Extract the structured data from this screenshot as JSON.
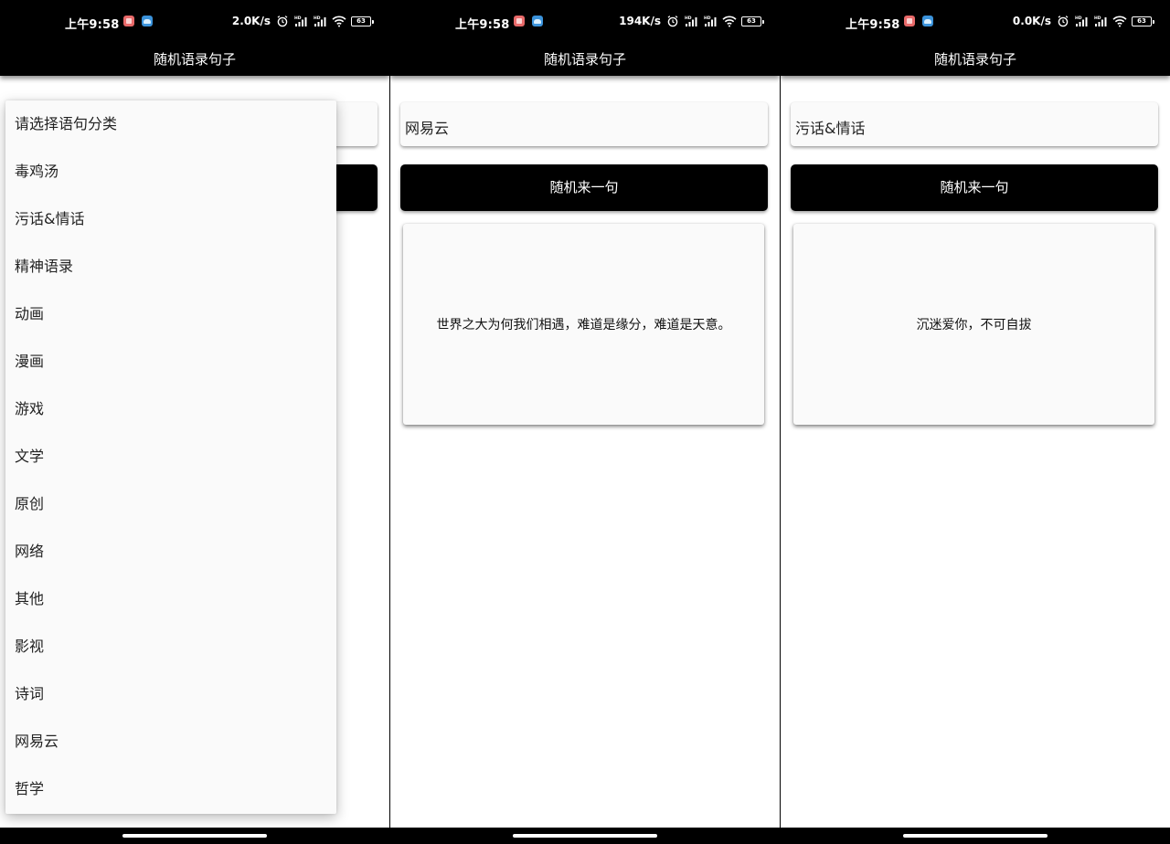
{
  "screens": [
    {
      "status": {
        "time": "上午9:58",
        "net_speed": "2.0K/s",
        "battery": "63"
      },
      "title": "随机语录句子",
      "spinner_value": "",
      "button_label": "随机来一句",
      "quote": "",
      "dropdown": {
        "open": true,
        "items": [
          "请选择语句分类",
          "毒鸡汤",
          "污话&情话",
          "精神语录",
          "动画",
          "漫画",
          "游戏",
          "文学",
          "原创",
          "网络",
          "其他",
          "影视",
          "诗词",
          "网易云",
          "哲学"
        ]
      }
    },
    {
      "status": {
        "time": "上午9:58",
        "net_speed": "194K/s",
        "battery": "63"
      },
      "title": "随机语录句子",
      "spinner_value": "网易云",
      "button_label": "随机来一句",
      "quote": "世界之大为何我们相遇，难道是缘分，难道是天意。"
    },
    {
      "status": {
        "time": "上午9:58",
        "net_speed": "0.0K/s",
        "battery": "63"
      },
      "title": "随机语录句子",
      "spinner_value": "污话&情话",
      "button_label": "随机来一句",
      "quote": "沉迷爱你，不可自拔"
    }
  ],
  "status_icons": [
    "notification-red-app-icon",
    "notification-blue-cloud-icon",
    "alarm-icon",
    "signal-hd-icon",
    "signal-hd-icon",
    "wifi-icon",
    "battery-icon"
  ],
  "colors": {
    "bar_bg": "#000000",
    "button_bg": "#000000",
    "button_text": "#ffffff",
    "card_bg": "#fafafa",
    "page_bg": "#ffffff"
  }
}
